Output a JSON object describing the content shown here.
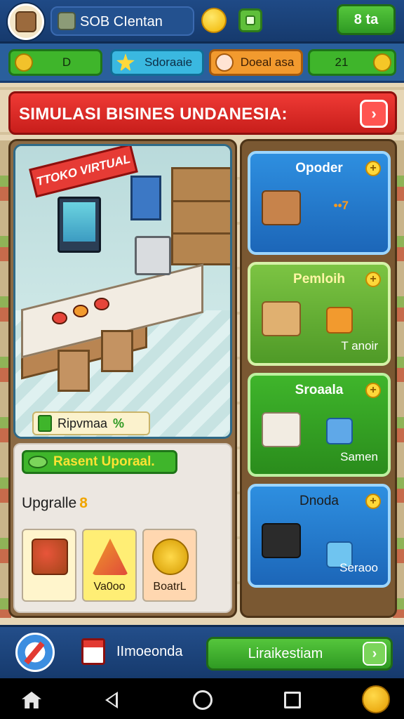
{
  "top_bar": {
    "title": "SOB CIentan",
    "button_label": "8 ta"
  },
  "stats": [
    {
      "label": "D",
      "icon": "coin-icon"
    },
    {
      "label": "Sdoraaie",
      "icon": "star-icon"
    },
    {
      "label": "Doeal asa",
      "icon": "heart-icon"
    },
    {
      "label": "21",
      "icon": "coin-icon"
    }
  ],
  "banner": {
    "title": "SIMULASI BISINES UNDANESIA:",
    "arrow": "›"
  },
  "store": {
    "sign": "TTOKO VIRTUAL",
    "percent_label": "Ripvmaa",
    "percent_value": "%"
  },
  "recent": {
    "label": "Rasent Uporaal."
  },
  "upgrades": {
    "heading": "Upgralle",
    "count": "8",
    "items": [
      {
        "label": ""
      },
      {
        "label": "Va0oo"
      },
      {
        "label": "BoatrL"
      }
    ]
  },
  "cards": [
    {
      "title": "Opoder",
      "sub": "••7"
    },
    {
      "title": "Pemloih",
      "sub": "T anoir"
    },
    {
      "title": "Sroaala",
      "sub": "Samen"
    },
    {
      "title": "Dnoda",
      "sub": "Seraoo"
    }
  ],
  "action_bar": {
    "label": "IImoeonda",
    "continue": "Liraikestiam",
    "arrow": "›"
  },
  "colors": {
    "primary_blue": "#1f4a86",
    "accent_green": "#3fb52b",
    "banner_red": "#e63b35",
    "coin_gold": "#f0b400"
  }
}
